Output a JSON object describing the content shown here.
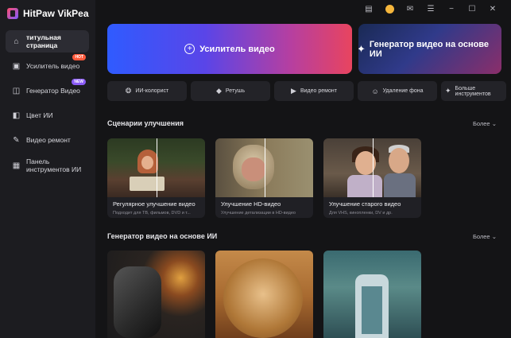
{
  "app": {
    "title": "HitPaw VikPea"
  },
  "sidebar": {
    "items": [
      {
        "label": "титульная страница",
        "icon": "home-icon",
        "active": true
      },
      {
        "label": "Усилитель видео",
        "icon": "video-enhance-icon",
        "badge": "HOT"
      },
      {
        "label": "Генератор Видео",
        "icon": "video-generate-icon",
        "badge": "NEW"
      },
      {
        "label": "Цвет ИИ",
        "icon": "color-icon"
      },
      {
        "label": "Видео ремонт",
        "icon": "repair-icon"
      },
      {
        "label": "Панель инструментов ИИ",
        "icon": "toolbox-icon"
      }
    ]
  },
  "topbar": {
    "icons": [
      "notes-icon",
      "avatar-icon",
      "mail-icon",
      "menu-icon",
      "minimize-icon",
      "maximize-icon",
      "close-icon"
    ]
  },
  "hero": {
    "enhancer_label": "Усилитель видео",
    "generator_label": "Генератор видео на основе ИИ"
  },
  "tools": [
    {
      "label": "ИИ-колорист",
      "icon": "palette-icon"
    },
    {
      "label": "Ретушь",
      "icon": "eraser-icon"
    },
    {
      "label": "Видео ремонт",
      "icon": "video-repair-icon"
    },
    {
      "label": "Удаление фона",
      "icon": "person-bg-icon"
    },
    {
      "label": "Больше инструментов",
      "icon": "sparkle-icon"
    }
  ],
  "scenarios": {
    "title": "Сценарии улучшения",
    "more_label": "Более",
    "cards": [
      {
        "title": "Регулярное улучшение видео",
        "subtitle": "Подходит для ТВ, фильмов, DVD и т..."
      },
      {
        "title": "Улучшение HD-видео",
        "subtitle": "Улучшение детализации в HD-видео"
      },
      {
        "title": "Улучшение старого видео",
        "subtitle": "Для VHS, кинопленки, DV и др."
      }
    ]
  },
  "generator": {
    "title": "Генератор видео на основе ИИ",
    "more_label": "Более"
  },
  "colors": {
    "background": "#141416",
    "sidebar": "#1c1c20",
    "hot_badge": "#ff5a3c",
    "new_badge": "#8b5cf6"
  }
}
